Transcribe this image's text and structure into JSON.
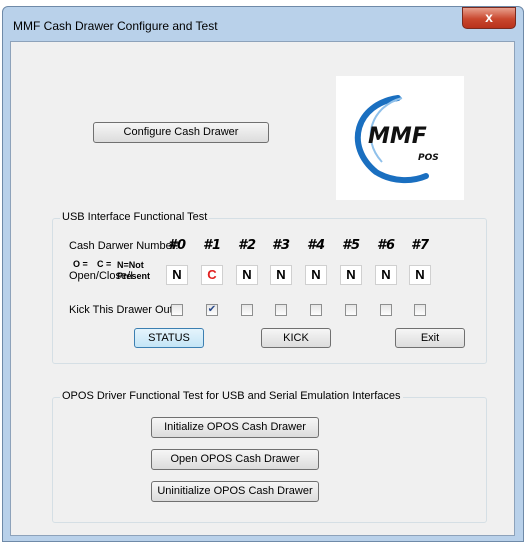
{
  "window": {
    "title": "MMF Cash Drawer Configure and Test",
    "close_glyph": "x"
  },
  "configure_button": "Configure Cash Drawer",
  "logo": {
    "brand": "MMF",
    "sub": "POS",
    "arc_color": "#1a6fc0"
  },
  "usb_group": {
    "title": "USB Interface Functional Test",
    "drawer_label": "Cash Darwer Number:",
    "legend": {
      "o": "O =",
      "c": "C =",
      "n": "N=Not",
      "line2": "Open/Close/I",
      "present": "Present"
    },
    "kick_label": "Kick This Drawer Out?",
    "drawers": [
      {
        "num": "#0",
        "status": "N",
        "kick": false
      },
      {
        "num": "#1",
        "status": "C",
        "kick": true
      },
      {
        "num": "#2",
        "status": "N",
        "kick": false
      },
      {
        "num": "#3",
        "status": "N",
        "kick": false
      },
      {
        "num": "#4",
        "status": "N",
        "kick": false
      },
      {
        "num": "#5",
        "status": "N",
        "kick": false
      },
      {
        "num": "#6",
        "status": "N",
        "kick": false
      },
      {
        "num": "#7",
        "status": "N",
        "kick": false
      }
    ],
    "status_button": "STATUS",
    "kick_button": "KICK",
    "exit_button": "Exit",
    "closed_color": "#e02020"
  },
  "opos_group": {
    "title": "OPOS Driver Functional Test for USB and Serial Emulation Interfaces",
    "init_button": "Initialize OPOS Cash Drawer",
    "open_button": "Open OPOS Cash Drawer",
    "uninit_button": "Uninitialize OPOS Cash Drawer"
  }
}
